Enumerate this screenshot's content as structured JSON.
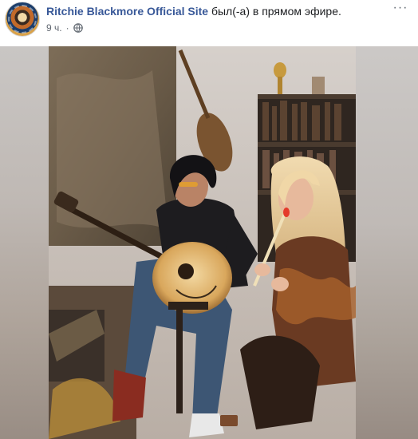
{
  "post": {
    "page_name": "Ritchie Blackmore Official Site",
    "live_text": "был(-а) в прямом эфире.",
    "timestamp": "9 ч.",
    "separator": "·",
    "privacy_icon": "globe-icon",
    "more_label": "···"
  },
  "video": {
    "scene": "live-video-two-musicians"
  },
  "colors": {
    "link": "#385898",
    "meta": "#606770",
    "text": "#1c1e21"
  }
}
